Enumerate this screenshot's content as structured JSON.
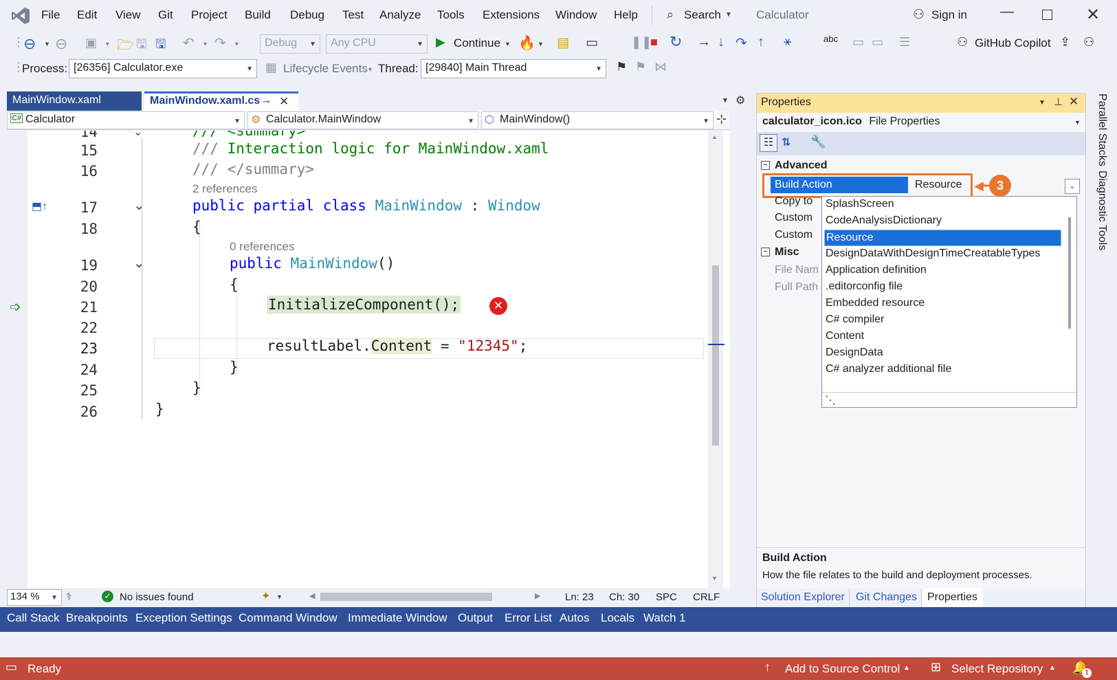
{
  "menu": {
    "items": [
      "File",
      "Edit",
      "View",
      "Git",
      "Project",
      "Build",
      "Debug",
      "Test",
      "Analyze",
      "Tools",
      "Extensions",
      "Window",
      "Help"
    ],
    "search_label": "Search",
    "solution_name": "Calculator",
    "sign_in": "Sign in"
  },
  "toolbar": {
    "config": "Debug",
    "platform": "Any CPU",
    "continue_label": "Continue",
    "copilot_label": "GitHub Copilot"
  },
  "debug_toolbar": {
    "process_label": "Process:",
    "process_value": "[26356] Calculator.exe",
    "lifecycle_label": "Lifecycle Events",
    "thread_label": "Thread:",
    "thread_value": "[29840] Main Thread"
  },
  "editor": {
    "tabs": [
      {
        "label": "MainWindow.xaml"
      },
      {
        "label": "MainWindow.xaml.cs"
      }
    ],
    "nav": {
      "project": "Calculator",
      "class": "Calculator.MainWindow",
      "member": "MainWindow()"
    },
    "lines": {
      "l14": "14",
      "l15": "15",
      "l16": "16",
      "l17": "17",
      "l18": "18",
      "l19": "19",
      "l20": "20",
      "l21": "21",
      "l22": "22",
      "l23": "23",
      "l24": "24",
      "l25": "25",
      "l26": "26"
    },
    "code": {
      "summary_top": "/// <summary>",
      "comment_slashes": "///",
      "comment_text": "Interaction logic for MainWindow.xaml",
      "summary_end": "/// </summary>",
      "refs_class": "2 references",
      "kw_public": "public",
      "kw_partial": "partial",
      "kw_class": "class",
      "class_name": "MainWindow",
      "colon": ":",
      "base_class": "Window",
      "brace_open": "{",
      "refs_ctor": "0 references",
      "ctor_name": "MainWindow",
      "parens": "()",
      "init_call": "InitializeComponent();",
      "result_obj": "resultLabel.",
      "result_prop": "Content",
      "assign": " = ",
      "result_str": "\"12345\"",
      "semicolon": ";",
      "brace_close": "}"
    },
    "status": {
      "zoom": "134 %",
      "issues": "No issues found",
      "line": "Ln: 23",
      "col": "Ch: 30",
      "spc": "SPC",
      "eol": "CRLF"
    }
  },
  "properties": {
    "title": "Properties",
    "object_name": "calculator_icon.ico",
    "object_type": "File Properties",
    "category_advanced": "Advanced",
    "build_action_label": "Build Action",
    "build_action_value": "Resource",
    "callout_number": "3",
    "rows": [
      "Copy to",
      "Custom",
      "Custom"
    ],
    "category_misc": "Misc",
    "misc_rows": [
      "File Nam",
      "Full Path"
    ],
    "dropdown_options": [
      "SplashScreen",
      "CodeAnalysisDictionary",
      "Resource",
      "DesignDataWithDesignTimeCreatableTypes",
      "Application definition",
      ".editorconfig file",
      "Embedded resource",
      "C# compiler",
      "Content",
      "DesignData",
      "C# analyzer additional file"
    ],
    "dropdown_selected": "Resource",
    "desc_title": "Build Action",
    "desc_text": "How the file relates to the build and deployment processes.",
    "tabs": [
      "Solution Explorer",
      "Git Changes",
      "Properties"
    ],
    "callout_color": "#e8772e"
  },
  "rail": {
    "items": [
      "Parallel Stacks",
      "Diagnostic Tools"
    ]
  },
  "tool_tabs": [
    "Call Stack",
    "Breakpoints",
    "Exception Settings",
    "Command Window",
    "Immediate Window",
    "Output",
    "Error List",
    "Autos",
    "Locals",
    "Watch 1"
  ],
  "statusbar": {
    "ready": "Ready",
    "source_control": "Add to Source Control",
    "repository": "Select Repository",
    "notifications": "1"
  }
}
